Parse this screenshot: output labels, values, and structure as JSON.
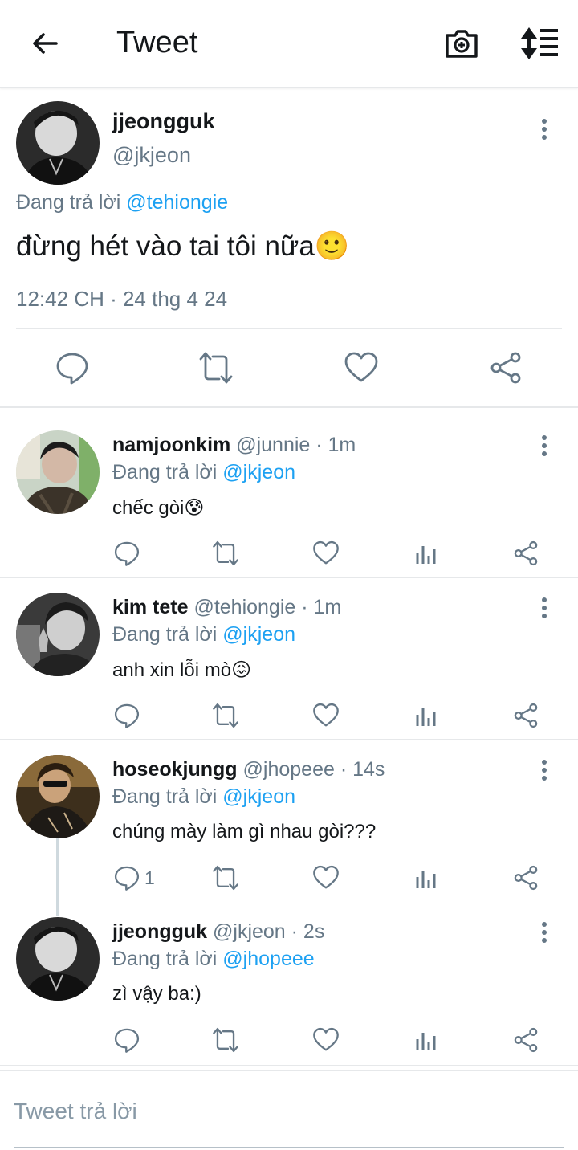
{
  "header": {
    "title": "Tweet"
  },
  "main_tweet": {
    "name": "jjeongguk",
    "handle": "@jkjeon",
    "replying_prefix": "Đang trả lời",
    "replying_to": "@tehiongie",
    "text": "đừng hét vào tai tôi nữa🙂",
    "timestamp": "12:42 CH · 24 thg 4 24"
  },
  "replies": [
    {
      "name": "namjoonkim",
      "handle": "@junnie · 1m",
      "replying_prefix": "Đang trả lời",
      "replying_to": "@jkjeon",
      "text": "chếc gòi😰"
    },
    {
      "name": "kim tete",
      "handle": "@tehiongie · 1m",
      "replying_prefix": "Đang trả lời",
      "replying_to": "@jkjeon",
      "text": "anh xin lỗi mò😖"
    },
    {
      "name": "hoseokjungg",
      "handle": "@jhopeee · 14s",
      "replying_prefix": "Đang trả lời",
      "replying_to": "@jkjeon",
      "text": "chúng mày làm gì nhau gòi???",
      "reply_count": "1"
    },
    {
      "name": "jjeongguk",
      "handle": "@jkjeon · 2s",
      "replying_prefix": "Đang trả lời",
      "replying_to": "@jhopeee",
      "text": "zì vậy ba:)"
    }
  ],
  "compose": {
    "placeholder": "Tweet trả lời"
  },
  "colors": {
    "link": "#1da1f2",
    "muted": "#657786",
    "divider": "#e6e8ea",
    "icon": "#657786"
  }
}
